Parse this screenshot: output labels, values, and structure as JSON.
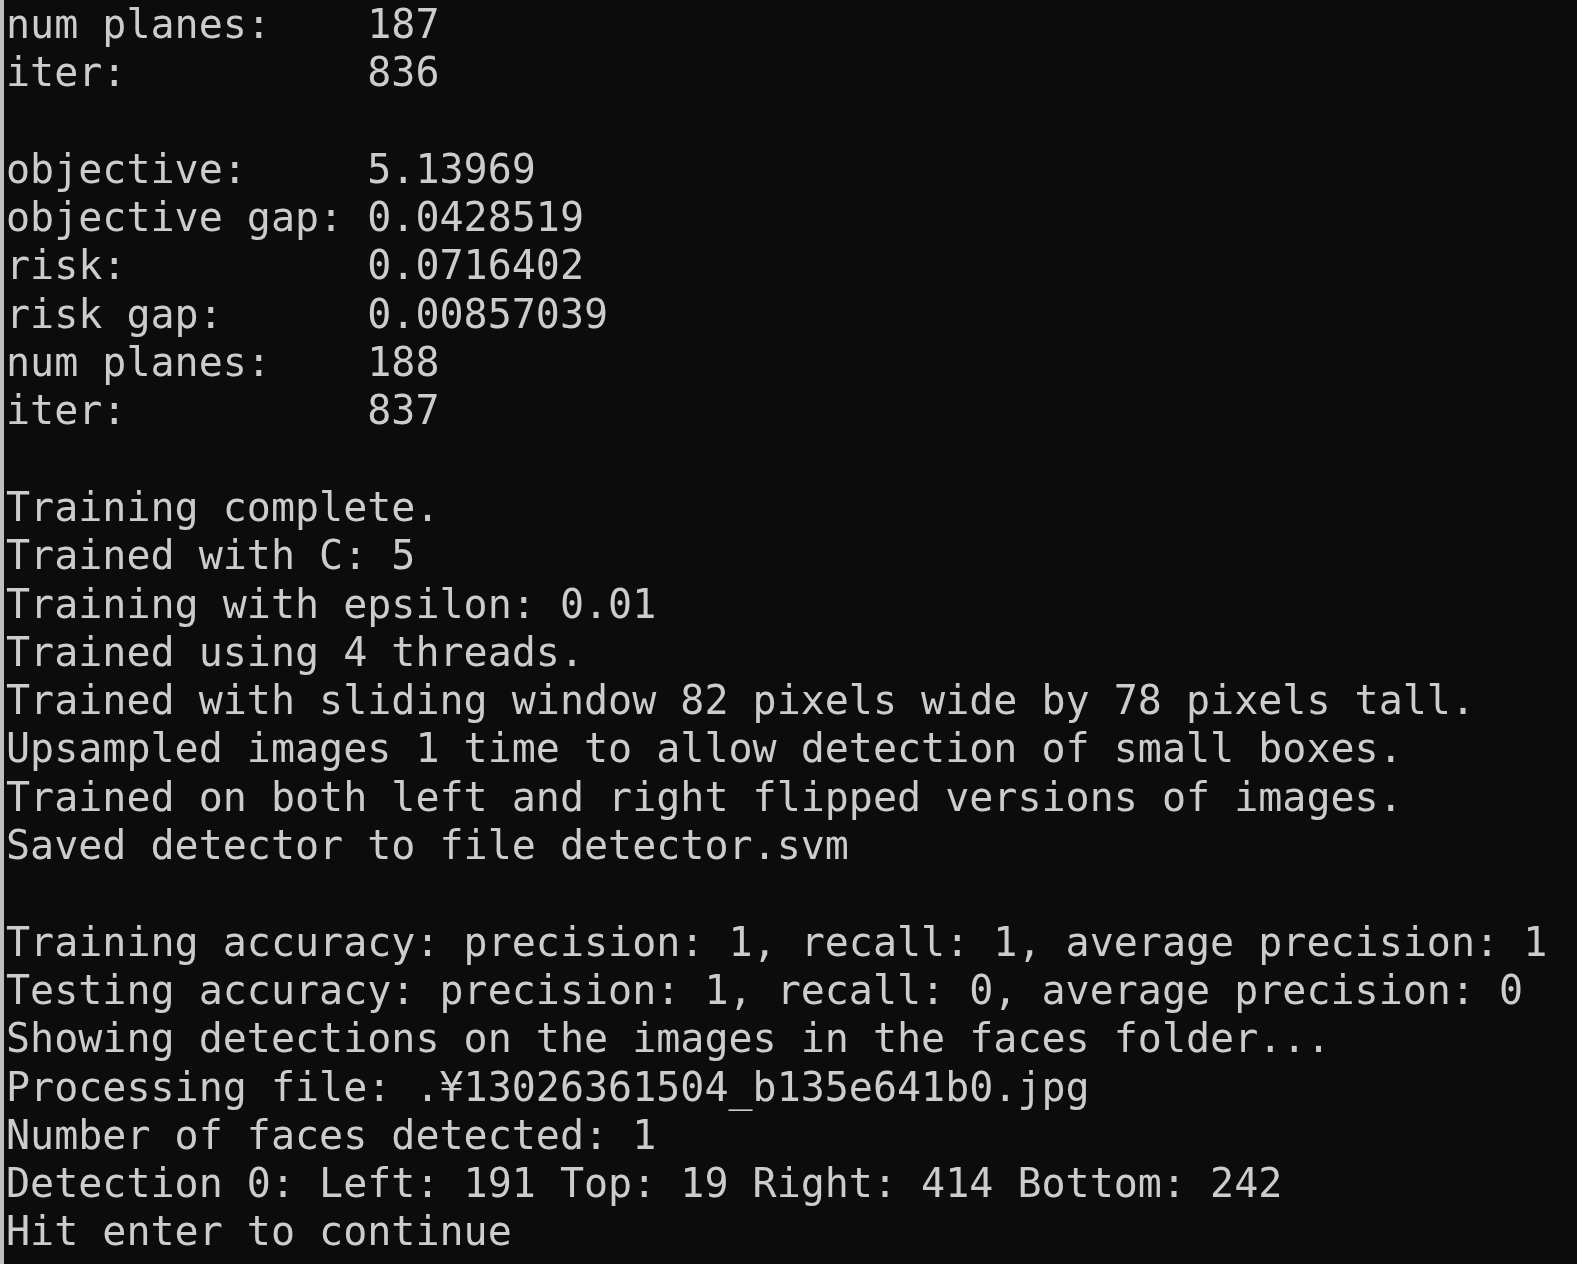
{
  "console": {
    "blocks": [
      [
        "num planes:    187",
        "iter:          836"
      ],
      [
        "objective:     5.13969",
        "objective gap: 0.0428519",
        "risk:          0.0716402",
        "risk gap:      0.00857039",
        "num planes:    188",
        "iter:          837"
      ],
      [
        "Training complete.",
        "Trained with C: 5",
        "Training with epsilon: 0.01",
        "Trained using 4 threads.",
        "Trained with sliding window 82 pixels wide by 78 pixels tall.",
        "Upsampled images 1 time to allow detection of small boxes.",
        "Trained on both left and right flipped versions of images.",
        "Saved detector to file detector.svm"
      ],
      [
        "Training accuracy: precision: 1, recall: 1, average precision: 1",
        "Testing accuracy: precision: 1, recall: 0, average precision: 0",
        "Showing detections on the images in the faces folder...",
        "Processing file: .¥13026361504_b135e641b0.jpg",
        "Number of faces detected: 1",
        "Detection 0: Left: 191 Top: 19 Right: 414 Bottom: 242",
        "Hit enter to continue"
      ]
    ]
  }
}
